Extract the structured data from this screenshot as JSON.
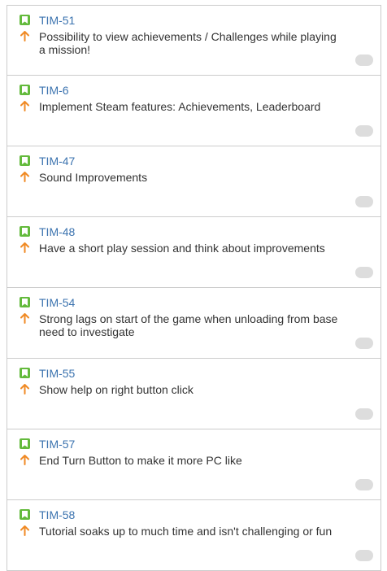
{
  "colors": {
    "story_green": "#63ba3c",
    "priority_orange": "#f08a24",
    "key_link": "#3b73af",
    "text": "#333333",
    "border": "#cccccc",
    "toggle": "#dddddd"
  },
  "icons": {
    "type": "story-bookmark-icon",
    "priority": "priority-up-arrow-icon",
    "toggle": "toggle-pill"
  },
  "cards": [
    {
      "key": "TIM-51",
      "summary": "Possibility to view achievements / Challenges while playing a mission!"
    },
    {
      "key": "TIM-6",
      "summary": "Implement Steam features: Achievements, Leaderboard"
    },
    {
      "key": "TIM-47",
      "summary": "Sound Improvements"
    },
    {
      "key": "TIM-48",
      "summary": "Have a short play session and think about improvements"
    },
    {
      "key": "TIM-54",
      "summary": "Strong lags on start of the game when unloading from base need to investigate"
    },
    {
      "key": "TIM-55",
      "summary": "Show help on right button click"
    },
    {
      "key": "TIM-57",
      "summary": "End Turn Button to make it more PC like"
    },
    {
      "key": "TIM-58",
      "summary": "Tutorial soaks up to much time and isn't challenging or fun"
    }
  ]
}
